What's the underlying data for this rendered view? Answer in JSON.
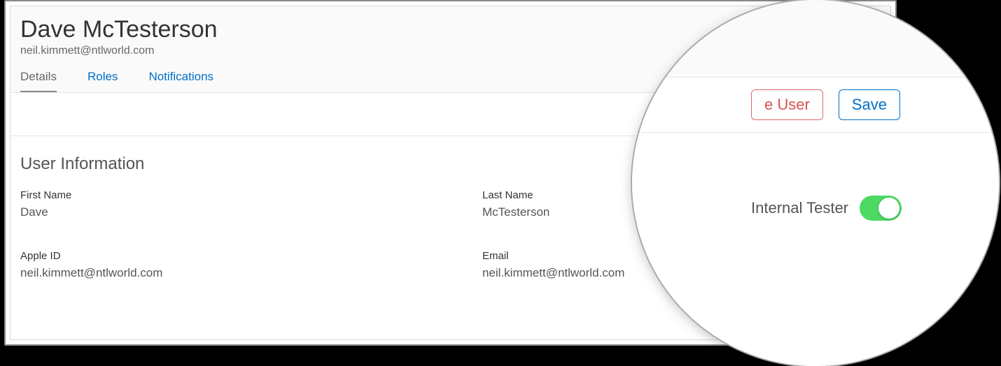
{
  "header": {
    "title": "Dave McTesterson",
    "subtitle": "neil.kimmett@ntlworld.com"
  },
  "tabs": [
    {
      "label": "Details",
      "active": true
    },
    {
      "label": "Roles",
      "active": false
    },
    {
      "label": "Notifications",
      "active": false
    }
  ],
  "actions": {
    "delete_label": "Delete User",
    "save_label": "Save"
  },
  "section": {
    "title": "User Information",
    "internal_tester_label": "Internal Tester",
    "internal_tester_on": true,
    "fields": {
      "first_name": {
        "label": "First Name",
        "value": "Dave"
      },
      "last_name": {
        "label": "Last Name",
        "value": "McTesterson"
      },
      "apple_id": {
        "label": "Apple ID",
        "value": "neil.kimmett@ntlworld.com"
      },
      "email": {
        "label": "Email",
        "value": "neil.kimmett@ntlworld.com"
      }
    }
  },
  "lens": {
    "delete_fragment": "e User",
    "save_label": "Save",
    "internal_tester_label": "Internal Tester"
  }
}
